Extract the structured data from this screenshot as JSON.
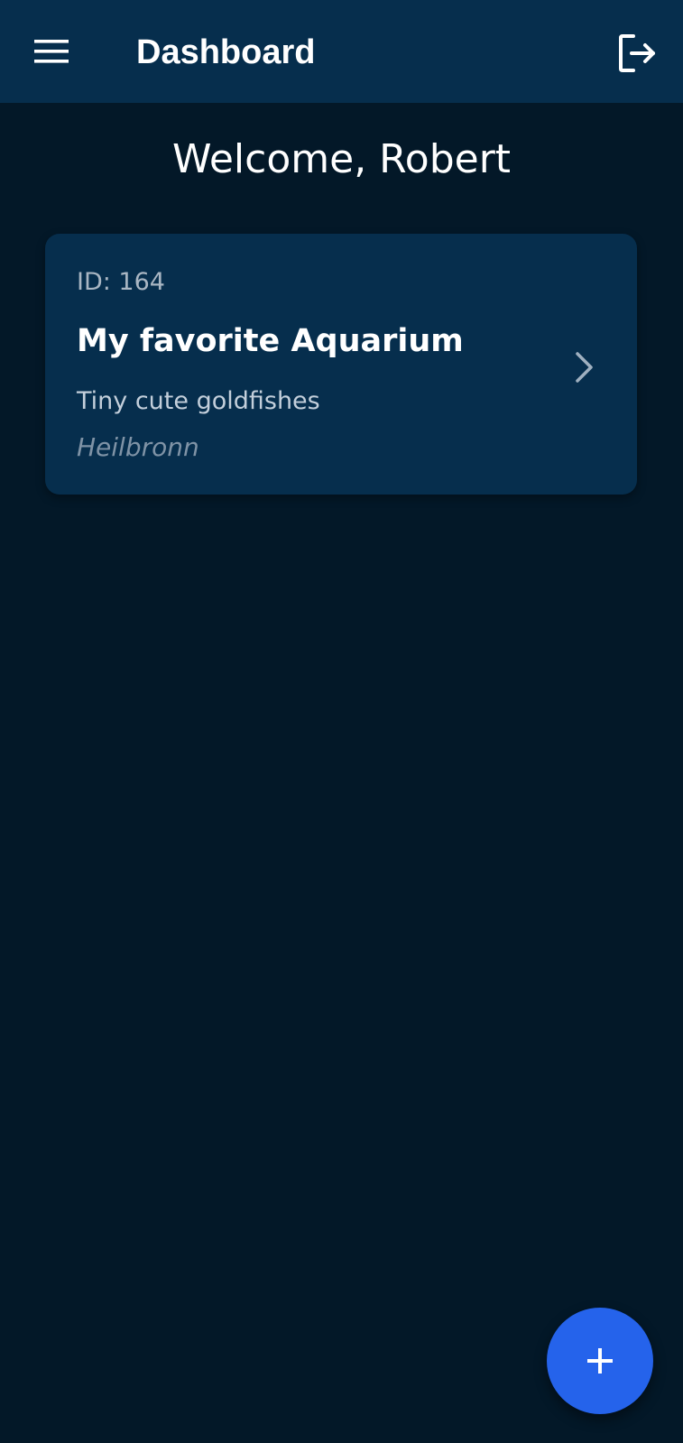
{
  "colors": {
    "background": "#031828",
    "app_bar": "#062e4d",
    "card": "#062e4d",
    "fab": "#2563eb",
    "text_primary": "#ffffff",
    "text_secondary": "#c3cfdb",
    "text_muted": "#7f93a6"
  },
  "app_bar": {
    "title": "Dashboard",
    "menu_icon": "menu-icon",
    "logout_icon": "logout-icon"
  },
  "welcome_text": "Welcome, Robert",
  "aquariums": [
    {
      "id_label": "ID: 164",
      "title": "My favorite Aquarium",
      "description": "Tiny cute goldfishes",
      "location": "Heilbronn",
      "chevron_icon": "chevron-right-icon"
    }
  ],
  "fab": {
    "icon": "plus-icon"
  }
}
